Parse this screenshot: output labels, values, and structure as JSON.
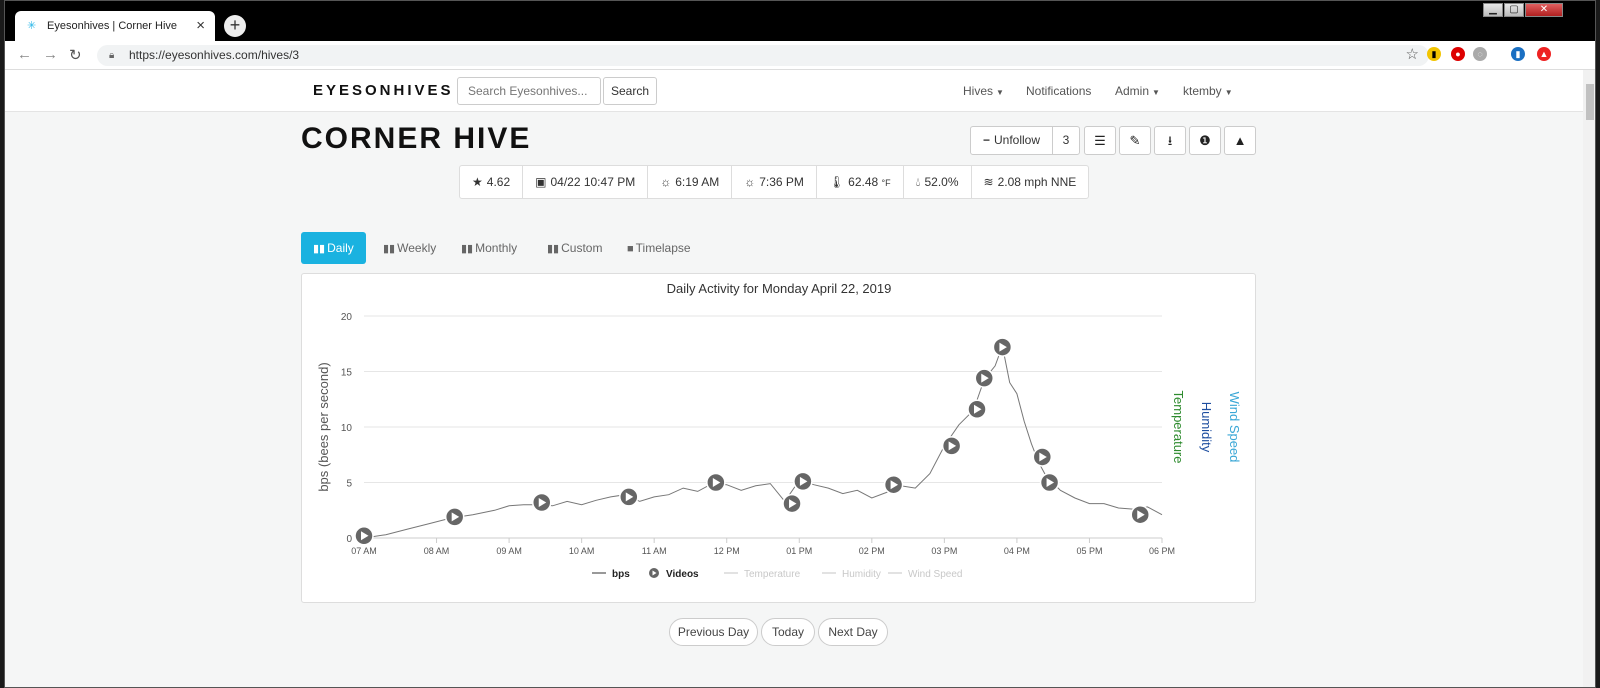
{
  "browser": {
    "tab_title": "Eyesonhives | Corner Hive",
    "url": "https://eyesonhives.com/hives/3",
    "new_tab": "+",
    "tab_close": "×"
  },
  "navbar": {
    "brand": "EYESONHIVES",
    "search_placeholder": "Search Eyesonhives...",
    "search_button": "Search",
    "menu": [
      {
        "label": "Hives",
        "has_caret": true
      },
      {
        "label": "Notifications",
        "has_caret": false
      },
      {
        "label": "Admin",
        "has_caret": true
      },
      {
        "label": "ktemby",
        "has_caret": true
      }
    ]
  },
  "hive": {
    "title": "CORNER HIVE",
    "unfollow_label": "Unfollow",
    "follower_count": "3",
    "action_icons": [
      "list-icon",
      "edit-icon",
      "download-icon",
      "info-icon",
      "bottle-icon"
    ]
  },
  "stats": {
    "rating": "4.62",
    "last_update": "04/22 10:47 PM",
    "sunrise": "6:19 AM",
    "sunset": "7:36 PM",
    "temperature": "62.48",
    "temperature_unit": "°F",
    "humidity": "52.0%",
    "wind": "2.08 mph NNE"
  },
  "tabs": [
    "Daily",
    "Weekly",
    "Monthly",
    "Custom",
    "Timelapse"
  ],
  "active_tab": "Daily",
  "pager": {
    "previous": "Previous Day",
    "today": "Today",
    "next": "Next Day"
  },
  "chart_data": {
    "type": "line",
    "title": "Daily Activity for Monday April 22, 2019",
    "ylabel": "bps (bees per second)",
    "right_axis_labels": [
      {
        "text": "Temperature",
        "color": "#2e8b2e"
      },
      {
        "text": "Humidity",
        "color": "#1f4fa0"
      },
      {
        "text": "Wind Speed",
        "color": "#3aa7d6"
      }
    ],
    "ylim": [
      0,
      20
    ],
    "yticks": [
      "0",
      "5",
      "10",
      "15",
      "20"
    ],
    "xlim": [
      7,
      18.0
    ],
    "xtick_values": [
      7,
      8,
      9,
      10,
      11,
      12,
      13,
      14,
      15,
      16,
      17,
      18
    ],
    "xticks": [
      "07 AM",
      "08 AM",
      "09 AM",
      "10 AM",
      "11 AM",
      "12 PM",
      "01 PM",
      "02 PM",
      "03 PM",
      "04 PM",
      "05 PM",
      "06 PM"
    ],
    "grid": true,
    "legend_position": "bottom",
    "series": [
      {
        "name": "bps",
        "color": "#777777",
        "points": [
          [
            7.0,
            0.0
          ],
          [
            7.3,
            0.3
          ],
          [
            7.6,
            0.8
          ],
          [
            7.9,
            1.3
          ],
          [
            8.2,
            1.8
          ],
          [
            8.5,
            2.1
          ],
          [
            8.8,
            2.5
          ],
          [
            9.0,
            2.9
          ],
          [
            9.2,
            3.0
          ],
          [
            9.4,
            3.0
          ],
          [
            9.6,
            2.9
          ],
          [
            9.8,
            3.3
          ],
          [
            10.0,
            3.0
          ],
          [
            10.2,
            3.4
          ],
          [
            10.4,
            3.7
          ],
          [
            10.6,
            3.9
          ],
          [
            10.8,
            3.3
          ],
          [
            11.0,
            3.7
          ],
          [
            11.2,
            3.9
          ],
          [
            11.4,
            4.5
          ],
          [
            11.6,
            4.2
          ],
          [
            11.8,
            4.9
          ],
          [
            12.0,
            4.8
          ],
          [
            12.2,
            4.3
          ],
          [
            12.4,
            4.7
          ],
          [
            12.6,
            4.9
          ],
          [
            12.8,
            3.3
          ],
          [
            13.0,
            5.2
          ],
          [
            13.2,
            4.8
          ],
          [
            13.4,
            4.5
          ],
          [
            13.6,
            4.0
          ],
          [
            13.8,
            4.3
          ],
          [
            14.0,
            3.6
          ],
          [
            14.2,
            4.1
          ],
          [
            14.4,
            4.7
          ],
          [
            14.6,
            4.5
          ],
          [
            14.8,
            5.8
          ],
          [
            15.0,
            8.3
          ],
          [
            15.2,
            10.2
          ],
          [
            15.4,
            11.5
          ],
          [
            15.55,
            14.3
          ],
          [
            15.7,
            15.5
          ],
          [
            15.8,
            17.3
          ],
          [
            15.9,
            14.0
          ],
          [
            16.0,
            13.0
          ],
          [
            16.1,
            10.5
          ],
          [
            16.2,
            8.5
          ],
          [
            16.3,
            6.8
          ],
          [
            16.4,
            5.6
          ],
          [
            16.6,
            4.3
          ],
          [
            16.8,
            3.6
          ],
          [
            17.0,
            3.1
          ],
          [
            17.2,
            3.1
          ],
          [
            17.4,
            2.7
          ],
          [
            17.6,
            2.6
          ],
          [
            17.8,
            2.8
          ],
          [
            18.0,
            2.1
          ]
        ]
      },
      {
        "name": "Temperature",
        "color": "#2e8b2e",
        "visible": false
      },
      {
        "name": "Humidity",
        "color": "#1f4fa0",
        "visible": false
      },
      {
        "name": "Wind Speed",
        "color": "#3aa7d6",
        "visible": false
      }
    ],
    "videos": [
      [
        7.0,
        0.2
      ],
      [
        8.25,
        1.9
      ],
      [
        9.45,
        3.2
      ],
      [
        10.65,
        3.7
      ],
      [
        11.85,
        5.0
      ],
      [
        12.9,
        3.1
      ],
      [
        13.05,
        5.1
      ],
      [
        14.3,
        4.8
      ],
      [
        15.1,
        8.3
      ],
      [
        15.45,
        11.6
      ],
      [
        15.55,
        14.4
      ],
      [
        15.8,
        17.2
      ],
      [
        16.35,
        7.3
      ],
      [
        16.45,
        5.0
      ],
      [
        17.7,
        2.1
      ]
    ],
    "legend": [
      {
        "label": "bps",
        "active": true
      },
      {
        "label": "Videos",
        "active": true
      },
      {
        "label": "Temperature",
        "active": false
      },
      {
        "label": "Humidity",
        "active": false
      },
      {
        "label": "Wind Speed",
        "active": false
      }
    ]
  }
}
